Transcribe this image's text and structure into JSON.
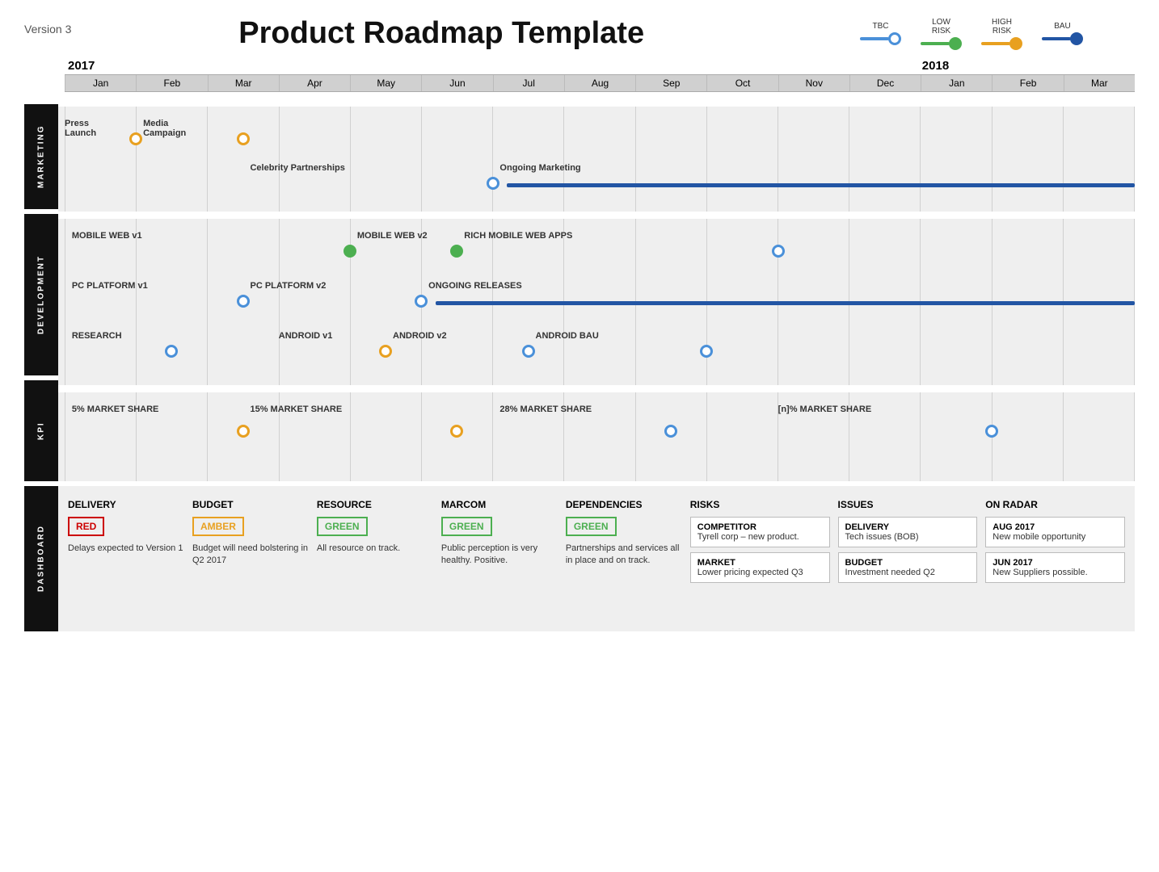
{
  "header": {
    "version": "Version 3",
    "title": "Product Roadmap Template",
    "legend": {
      "tbc": {
        "label": "TBC",
        "color": "#4a90d9"
      },
      "low_risk": {
        "label": "LOW\nRISK",
        "color": "#4caf50"
      },
      "high_risk": {
        "label": "HIGH\nRISK",
        "color": "#e8a020"
      },
      "bau": {
        "label": "BAU",
        "color": "#2255a4"
      }
    }
  },
  "timeline": {
    "years": [
      {
        "label": "2017",
        "months": [
          "Jan",
          "Feb",
          "Mar",
          "Apr",
          "May",
          "Jun",
          "Jul",
          "Aug",
          "Sep",
          "Oct",
          "Nov",
          "Dec"
        ]
      },
      {
        "label": "2018",
        "months": [
          "Jan",
          "Feb",
          "Mar"
        ]
      }
    ]
  },
  "sections": {
    "marketing": {
      "label": "MARKETING",
      "rows": [
        {
          "label": "Press Launch",
          "bar_color": "orange",
          "start": 0,
          "end": 1,
          "milestone_at": 1
        },
        {
          "label": "Media Campaign",
          "bar_color": "orange",
          "start": 1,
          "end": 2.5,
          "milestone_at": 2.5
        },
        {
          "label": "Celebrity Partnerships",
          "bar_color": "blue",
          "start": 2.5,
          "end": 6,
          "milestone_at": 6
        },
        {
          "label": "Ongoing Marketing",
          "bar_color": "darkblue",
          "start": 6,
          "end": 15,
          "milestone_at": null
        }
      ]
    },
    "development": {
      "label": "DEVELOPMENT",
      "rows": [
        {
          "label": "MOBILE WEB v1",
          "bar_color": "green",
          "start": 0,
          "end": 4,
          "milestone_at": 4,
          "label2": "MOBILE WEB v2",
          "start2": 4,
          "end2": 5.5,
          "milestone_at2": 5.5,
          "label3": "RICH MOBILE WEB APPS",
          "start3": 5.5,
          "end3": 10,
          "milestone_at3": 10,
          "bar_color2": "green",
          "bar_color3": "blue"
        },
        {
          "label": "PC PLATFORM v1",
          "bar_color": "blue",
          "start": 0,
          "end": 2.5,
          "milestone_at": 2.5,
          "label2": "PC PLATFORM v2",
          "start2": 2.5,
          "end2": 5,
          "milestone_at2": 5,
          "label3": "ONGOING RELEASES",
          "start3": 5,
          "end3": 15,
          "milestone_at3": null,
          "bar_color2": "blue",
          "bar_color3": "darkblue"
        },
        {
          "label": "RESEARCH",
          "bar_color": "blue",
          "start": 0,
          "end": 1.5,
          "milestone_at": 1.5,
          "label2": "ANDROID v1",
          "start2": 3,
          "end2": 4.5,
          "milestone_at2": 4.5,
          "label3": "ANDROID v2",
          "start3": 4.5,
          "end3": 6.5,
          "milestone_at3": 6.5,
          "label4": "ANDROID BAU",
          "start4": 6.5,
          "end4": 9,
          "milestone_at4": 9,
          "bar_color2": "orange",
          "bar_color3": "blue",
          "bar_color4": "blue"
        }
      ]
    },
    "kpi": {
      "label": "KPI",
      "rows": [
        {
          "label": "5% MARKET SHARE",
          "start": 0,
          "end": 2.5,
          "milestone_at": 2.5,
          "bar_color": "orange"
        },
        {
          "label": "15% MARKET SHARE",
          "start": 2.5,
          "end": 5.5,
          "milestone_at": 5.5,
          "bar_color": "orange"
        },
        {
          "label": "28% MARKET SHARE",
          "start": 5.5,
          "end": 8.5,
          "milestone_at": 8.5,
          "bar_color": "blue"
        },
        {
          "label": "[n]% MARKET SHARE",
          "start": 10,
          "end": 13,
          "milestone_at": 13,
          "bar_color": "blue"
        }
      ]
    }
  },
  "dashboard": {
    "label": "DASHBOARD",
    "columns": {
      "delivery": {
        "title": "DELIVERY",
        "status": "RED",
        "status_type": "red",
        "text": "Delays expected to Version 1"
      },
      "budget": {
        "title": "BUDGET",
        "status": "AMBER",
        "status_type": "amber",
        "text": "Budget will need bolstering in Q2 2017"
      },
      "resource": {
        "title": "RESOURCE",
        "status": "GREEN",
        "status_type": "green",
        "text": "All resource on track."
      },
      "marcom": {
        "title": "MARCOM",
        "status": "GREEN",
        "status_type": "green",
        "text": "Public perception is very healthy. Positive."
      },
      "dependencies": {
        "title": "DEPENDENCIES",
        "status": "GREEN",
        "status_type": "green",
        "text": "Partnerships and services all in place and on track."
      },
      "risks": {
        "title": "RISKS",
        "items": [
          {
            "title": "COMPETITOR",
            "text": "Tyrell corp – new product."
          },
          {
            "title": "MARKET",
            "text": "Lower pricing expected Q3"
          }
        ]
      },
      "issues": {
        "title": "ISSUES",
        "items": [
          {
            "title": "DELIVERY",
            "text": "Tech issues (BOB)"
          },
          {
            "title": "BUDGET",
            "text": "Investment needed Q2"
          }
        ]
      },
      "on_radar": {
        "title": "ON RADAR",
        "items": [
          {
            "title": "AUG 2017",
            "text": "New mobile opportunity"
          },
          {
            "title": "JUN 2017",
            "text": "New Suppliers possible."
          }
        ]
      }
    }
  }
}
